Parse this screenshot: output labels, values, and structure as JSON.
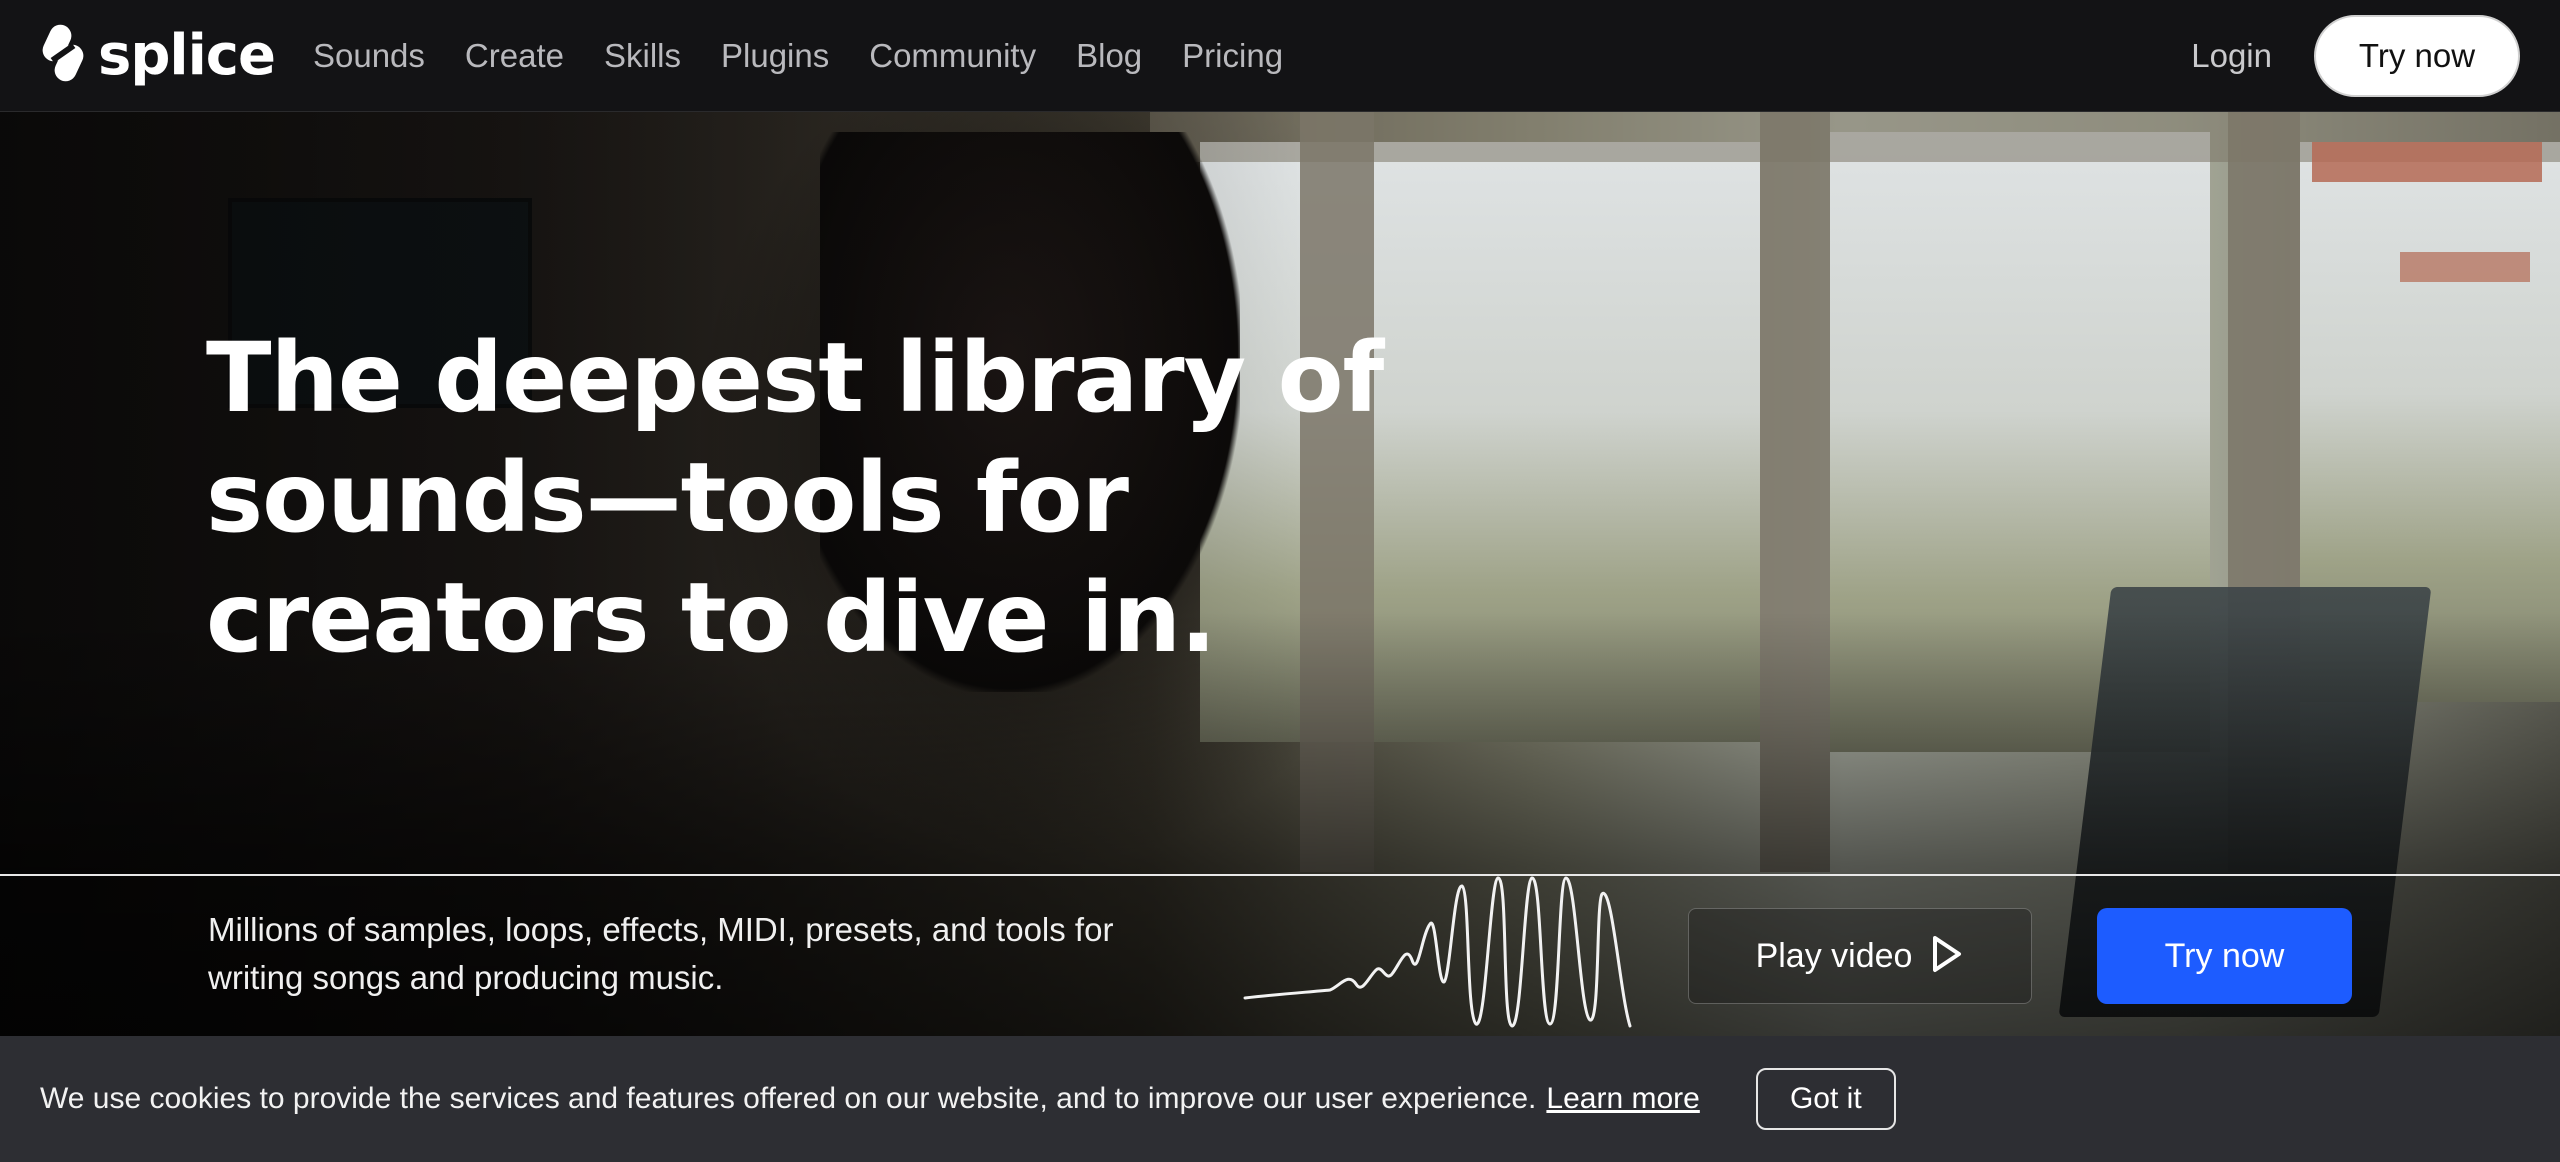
{
  "nav": {
    "logo_text": "splice",
    "links": [
      "Sounds",
      "Create",
      "Skills",
      "Plugins",
      "Community",
      "Blog",
      "Pricing"
    ],
    "login": "Login",
    "try_now": "Try now"
  },
  "hero": {
    "headline": "The deepest library of sounds—tools for creators to dive in.",
    "subtext": "Millions of samples, loops, effects, MIDI, presets, and tools for writing songs and producing music.",
    "play_video": "Play video",
    "try_now": "Try now"
  },
  "cookie": {
    "message": "We use cookies to provide the services and features offered on our website, and to improve our user experience.",
    "learn_more": "Learn more",
    "got_it": "Got it"
  },
  "colors": {
    "nav_bg": "#131315",
    "primary": "#1d5cff",
    "cookie_bg": "#2d2e33"
  },
  "icons": {
    "logo": "splice-logo-icon",
    "play": "play-icon",
    "waveform": "waveform-icon"
  }
}
